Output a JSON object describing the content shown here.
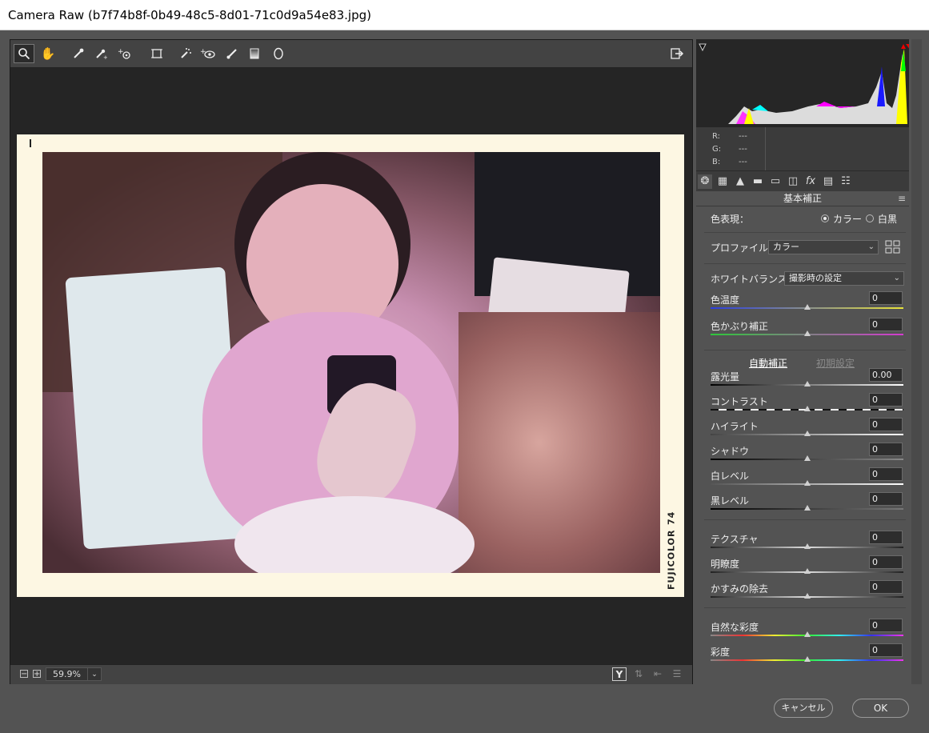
{
  "window": {
    "title": "Camera Raw (b7f74b8f-0b49-48c5-8d01-71c0d9a54e83.jpg)"
  },
  "toolbar": {
    "tools": [
      {
        "name": "zoom-tool",
        "icon": "magnifier-icon",
        "glyph": "⚲"
      },
      {
        "name": "hand-tool",
        "icon": "hand-icon",
        "glyph": "✋"
      },
      {
        "name": "white-balance-tool",
        "icon": "eyedropper-icon",
        "glyph": "✎"
      },
      {
        "name": "color-sampler-tool",
        "icon": "color-sampler-icon",
        "glyph": "✐"
      },
      {
        "name": "targeted-adjustment-tool",
        "icon": "target-icon",
        "glyph": "⊙"
      },
      {
        "name": "transform-tool",
        "icon": "transform-icon",
        "glyph": "⌗"
      },
      {
        "name": "spot-removal-tool",
        "icon": "spot-removal-icon",
        "glyph": "✧"
      },
      {
        "name": "red-eye-tool",
        "icon": "red-eye-icon",
        "glyph": "◉"
      },
      {
        "name": "adjustment-brush-tool",
        "icon": "brush-icon",
        "glyph": "✏"
      },
      {
        "name": "graduated-filter-tool",
        "icon": "graduated-filter-icon",
        "glyph": "▮"
      },
      {
        "name": "radial-filter-tool",
        "icon": "radial-filter-icon",
        "glyph": "◯"
      }
    ],
    "open_preferences_icon": "⇨"
  },
  "photo": {
    "film_brand": "FUJICOLOR",
    "frame_number": "74"
  },
  "bottombar": {
    "zoom_out": "−",
    "zoom_in": "+",
    "zoom_level": "59.9%",
    "zoom_arrow": "⌄",
    "before_after": "Y"
  },
  "readout": {
    "r_label": "R:",
    "g_label": "G:",
    "b_label": "B:",
    "r": "---",
    "g": "---",
    "b": "---"
  },
  "panel": {
    "section_title": "基本補正",
    "treatment_label": "色表現：",
    "treatment_color": "カラー",
    "treatment_bw": "白黒",
    "profile_label": "プロファイル：",
    "profile_value": "カラー",
    "wb_label": "ホワイトバランス：",
    "wb_value": "撮影時の設定",
    "auto_label": "自動補正",
    "default_label": "初期設定",
    "sliders": [
      {
        "key": "temperature",
        "label": "色温度",
        "value": "0",
        "pos": 0.5
      },
      {
        "key": "tint",
        "label": "色かぶり補正",
        "value": "0",
        "pos": 0.5
      },
      {
        "key": "exposure",
        "label": "露光量",
        "value": "0.00",
        "pos": 0.5
      },
      {
        "key": "contrast",
        "label": "コントラスト",
        "value": "0",
        "pos": 0.5
      },
      {
        "key": "highlights",
        "label": "ハイライト",
        "value": "0",
        "pos": 0.5
      },
      {
        "key": "shadows",
        "label": "シャドウ",
        "value": "0",
        "pos": 0.5
      },
      {
        "key": "whites",
        "label": "白レベル",
        "value": "0",
        "pos": 0.5
      },
      {
        "key": "blacks",
        "label": "黒レベル",
        "value": "0",
        "pos": 0.5
      },
      {
        "key": "texture",
        "label": "テクスチャ",
        "value": "0",
        "pos": 0.5
      },
      {
        "key": "clarity",
        "label": "明瞭度",
        "value": "0",
        "pos": 0.5
      },
      {
        "key": "dehaze",
        "label": "かすみの除去",
        "value": "0",
        "pos": 0.5
      },
      {
        "key": "vibrance",
        "label": "自然な彩度",
        "value": "0",
        "pos": 0.5
      },
      {
        "key": "saturation",
        "label": "彩度",
        "value": "0",
        "pos": 0.5
      }
    ]
  },
  "buttons": {
    "cancel": "キャンセル",
    "ok": "OK"
  }
}
